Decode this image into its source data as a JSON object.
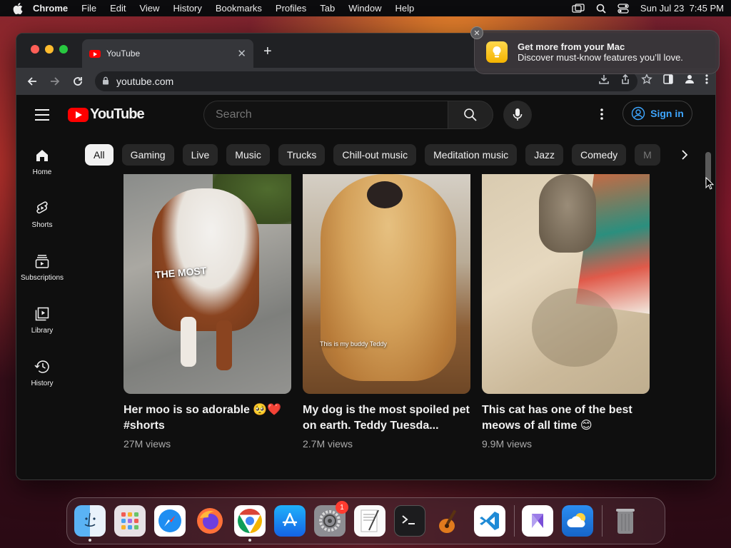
{
  "menubar": {
    "app": "Chrome",
    "items": [
      "File",
      "Edit",
      "View",
      "History",
      "Bookmarks",
      "Profiles",
      "Tab",
      "Window",
      "Help"
    ],
    "clock": "Sun Jul 23  7:45 PM"
  },
  "browser": {
    "tab_title": "YouTube",
    "url": "youtube.com"
  },
  "youtube": {
    "logo_text": "YouTube",
    "search_placeholder": "Search",
    "signin_label": "Sign in",
    "sidebar": [
      {
        "label": "Home",
        "icon": "home-icon"
      },
      {
        "label": "Shorts",
        "icon": "shorts-icon"
      },
      {
        "label": "Subscriptions",
        "icon": "subscriptions-icon"
      },
      {
        "label": "Library",
        "icon": "library-icon"
      },
      {
        "label": "History",
        "icon": "history-icon"
      }
    ],
    "chips": [
      "All",
      "Gaming",
      "Live",
      "Music",
      "Trucks",
      "Chill-out music",
      "Meditation music",
      "Jazz",
      "Comedy",
      "M"
    ],
    "videos": [
      {
        "title": "Her moo is so adorable 🥺❤️ #shorts",
        "views": "27M views",
        "caption": "THE MOST"
      },
      {
        "title": "My dog is the most spoiled pet on earth. Teddy Tuesda...",
        "views": "2.7M views",
        "caption": "This is my buddy Teddy"
      },
      {
        "title": "This cat has one of the best meows of all time 😊",
        "views": "9.9M views",
        "caption": ""
      }
    ]
  },
  "notification": {
    "title": "Get more from your Mac",
    "subtitle": "Discover must-know features you’ll love."
  },
  "dock": {
    "apps": [
      "finder",
      "launchpad",
      "safari",
      "firefox",
      "chrome",
      "app-store",
      "system-settings",
      "textedit",
      "terminal",
      "garageband",
      "vscode",
      "visual-studio",
      "weather",
      "trash"
    ],
    "settings_badge": "1"
  },
  "colors": {
    "youtube_red": "#ff0000",
    "signin_blue": "#3ea6ff",
    "page_bg": "#0f0f0f"
  }
}
